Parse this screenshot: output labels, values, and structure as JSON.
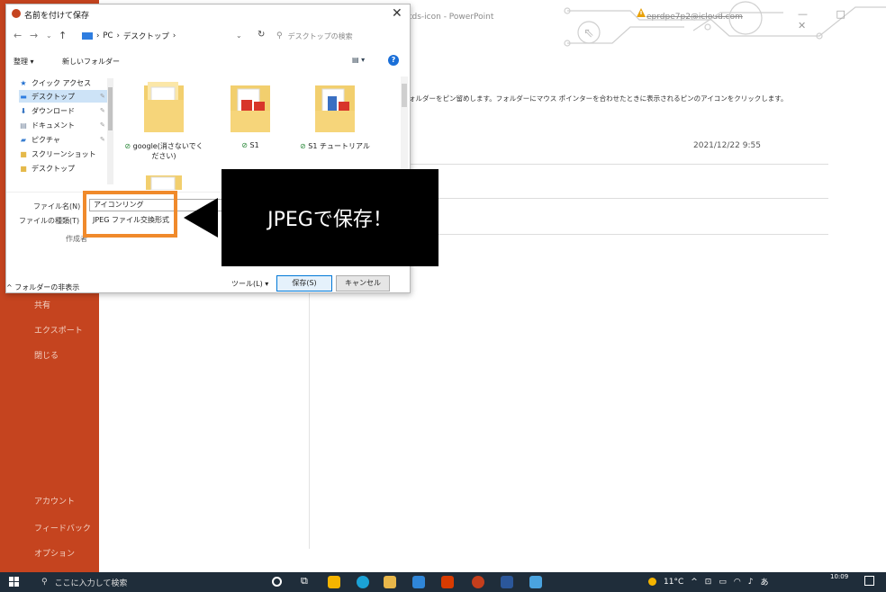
{
  "powerpoint": {
    "window_title": "tds-icon - PowerPoint",
    "account": "eprdpe7p2@icloud.com",
    "pin_help": "ォルダーをピン留めします。フォルダーにマウス ポインターを合わせたときに表示されるピンのアイコンをクリックします。",
    "date": "2021/12/22 9:55",
    "sidebar": [
      "共有",
      "エクスポート",
      "閉じる",
      "アカウント",
      "フィードバック",
      "オプション"
    ],
    "controls": "—  □  ✕"
  },
  "dialog": {
    "title": "名前を付けて保存",
    "close": "✕",
    "breadcrumb": [
      "PC",
      "デスクトップ"
    ],
    "search_placeholder": "デスクトップの検索",
    "organize": "整理 ▾",
    "new_folder": "新しいフォルダー",
    "nav_items": [
      {
        "label": "クイック アクセス",
        "icon": "star-icon"
      },
      {
        "label": "デスクトップ",
        "icon": "desktop-icon"
      },
      {
        "label": "ダウンロード",
        "icon": "download-icon"
      },
      {
        "label": "ドキュメント",
        "icon": "document-icon"
      },
      {
        "label": "ピクチャ",
        "icon": "picture-icon"
      },
      {
        "label": "スクリーンショット",
        "icon": "folder-icon"
      },
      {
        "label": "デスクトップ",
        "icon": "folder-icon"
      }
    ],
    "files": [
      {
        "name": "google(消さないでください)",
        "status": "synced"
      },
      {
        "name": "S1",
        "status": "synced"
      },
      {
        "name": "S1 チュートリアル",
        "status": "synced"
      }
    ],
    "filename_label": "ファイル名(N)",
    "filename_value": "アイコンリング",
    "filetype_label": "ファイルの種類(T)",
    "filetype_value": "JPEG ファイル交換形式",
    "author_label": "作成者",
    "hide_folders": "フォルダーの非表示",
    "tools": "ツール(L) ▾",
    "save": "保存(S)",
    "cancel": "キャンセル"
  },
  "callout": {
    "text": "JPEGで保存！"
  },
  "taskbar": {
    "search_placeholder": "ここに入力して検索",
    "weather": "11°C",
    "ime": "あ",
    "time": "10:09"
  }
}
